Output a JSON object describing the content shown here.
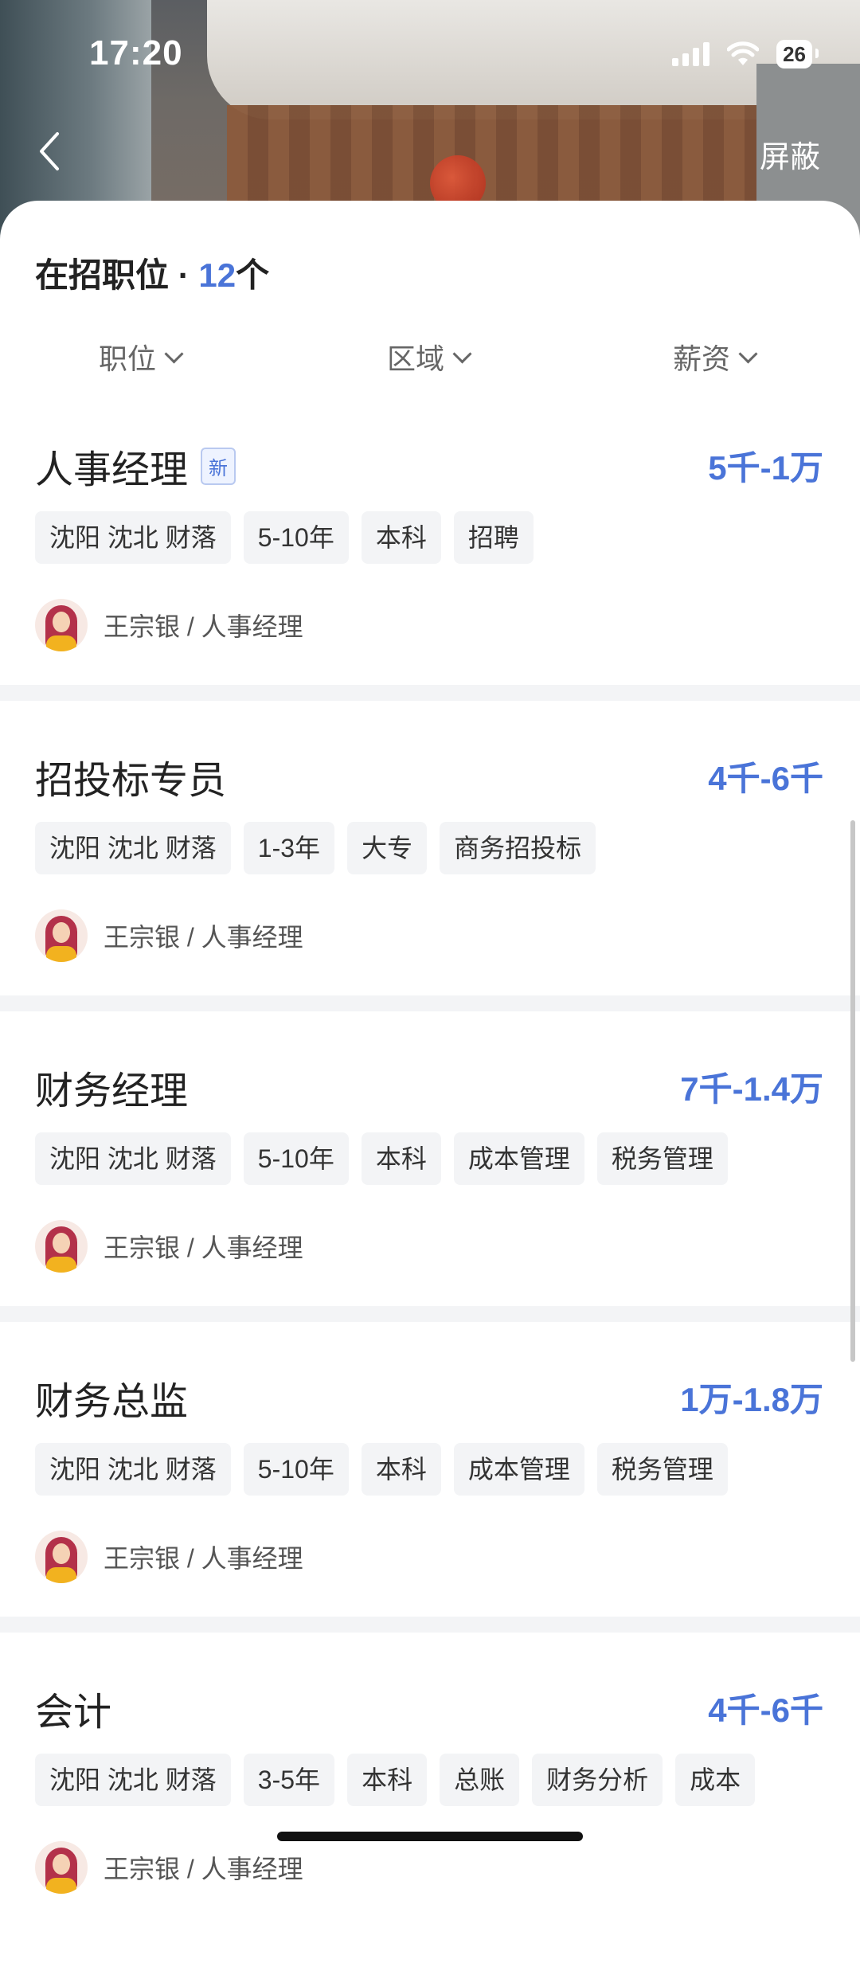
{
  "status_bar": {
    "time": "17:20",
    "battery": "26"
  },
  "nav": {
    "block_label": "屏蔽"
  },
  "sheet": {
    "title": "在招职位",
    "dot": "·",
    "count": "12",
    "count_unit": "个"
  },
  "filters": [
    {
      "label": "职位"
    },
    {
      "label": "区域"
    },
    {
      "label": "薪资"
    }
  ],
  "jobs": [
    {
      "title": "人事经理",
      "badge": "新",
      "salary": "5千-1万",
      "tags": [
        "沈阳 沈北 财落",
        "5-10年",
        "本科",
        "招聘"
      ],
      "recruiter": "王宗银 / 人事经理"
    },
    {
      "title": "招投标专员",
      "salary": "4千-6千",
      "tags": [
        "沈阳 沈北 财落",
        "1-3年",
        "大专",
        "商务招投标"
      ],
      "recruiter": "王宗银 / 人事经理"
    },
    {
      "title": "财务经理",
      "salary": "7千-1.4万",
      "tags": [
        "沈阳 沈北 财落",
        "5-10年",
        "本科",
        "成本管理",
        "税务管理"
      ],
      "recruiter": "王宗银 / 人事经理"
    },
    {
      "title": "财务总监",
      "salary": "1万-1.8万",
      "tags": [
        "沈阳 沈北 财落",
        "5-10年",
        "本科",
        "成本管理",
        "税务管理"
      ],
      "recruiter": "王宗银 / 人事经理"
    },
    {
      "title": "会计",
      "salary": "4千-6千",
      "tags": [
        "沈阳 沈北 财落",
        "3-5年",
        "本科",
        "总账",
        "财务分析",
        "成本"
      ],
      "recruiter": "王宗银 / 人事经理"
    }
  ],
  "colors": {
    "accent": "#4a74d8",
    "tag_bg": "#f3f4f6",
    "divider": "#f3f4f6"
  }
}
